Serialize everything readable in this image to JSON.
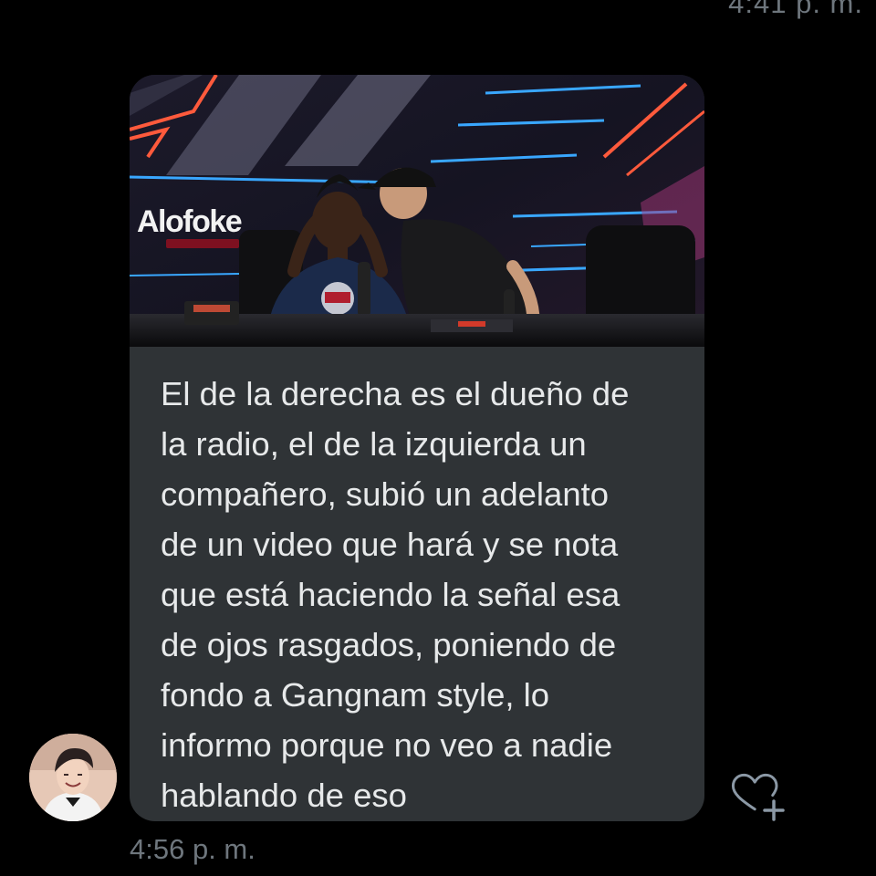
{
  "conversation": {
    "previous_timestamp": "4:41 p. m.",
    "message": {
      "image": {
        "brand_text": "Alofoke"
      },
      "lines": [
        "El de la derecha es el dueño de",
        "la radio, el de la izquierda un",
        "compañero, subió un adelanto",
        "de un video que hará y se nota",
        "que está haciendo la señal esa",
        "de ojos rasgados, poniendo de",
        "fondo a Gangnam style, lo",
        "informo porque no veo a nadie",
        "hablando de eso"
      ],
      "timestamp": "4:56 p. m."
    },
    "react_icon": "heart-plus-icon"
  },
  "colors": {
    "background": "#000000",
    "bubble": "#2f3336",
    "text": "#e7e9ea",
    "muted": "#6e767d",
    "neon_orange": "#ff5a3c",
    "neon_blue": "#39a7ff"
  }
}
